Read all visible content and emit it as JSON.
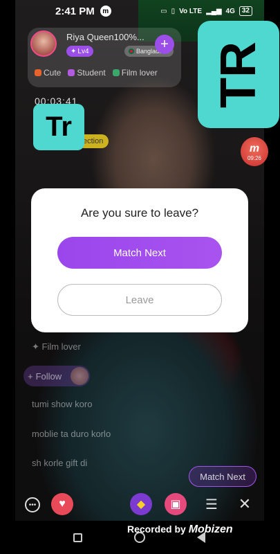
{
  "status_bar": {
    "time": "2:41 PM",
    "m_icon": "m",
    "signal_text": "Vo LTE",
    "net_text": "4G",
    "battery": "32"
  },
  "host": {
    "name": "Riya Queen100%...",
    "level": "Lv4",
    "country": "Bangladesh",
    "tags": [
      {
        "label": "Cute",
        "color": "#e8622c"
      },
      {
        "label": "Student",
        "color": "#b25be0"
      },
      {
        "label": "Film lover",
        "color": "#3aa76b"
      }
    ]
  },
  "timer": "00:03:41",
  "connection_label": "ection",
  "watermark": {
    "large": "TR",
    "small": "Tr"
  },
  "mobizen_badge": {
    "letter": "m",
    "time": "09:26"
  },
  "dialog": {
    "title": "Are you sure to leave?",
    "primary": "Match Next",
    "secondary": "Leave"
  },
  "chat": {
    "tag_line": "Film lover",
    "follow": "Follow",
    "messages": [
      "tumi show koro",
      "moblie ta duro korlo",
      "sh korle gift di"
    ]
  },
  "match_next_pill": "Match Next",
  "recorder": {
    "prefix": "Recorded by",
    "brand": "Mobizen"
  },
  "colors": {
    "accent": "#9b4ee8",
    "watermark": "#4fd8d0"
  }
}
